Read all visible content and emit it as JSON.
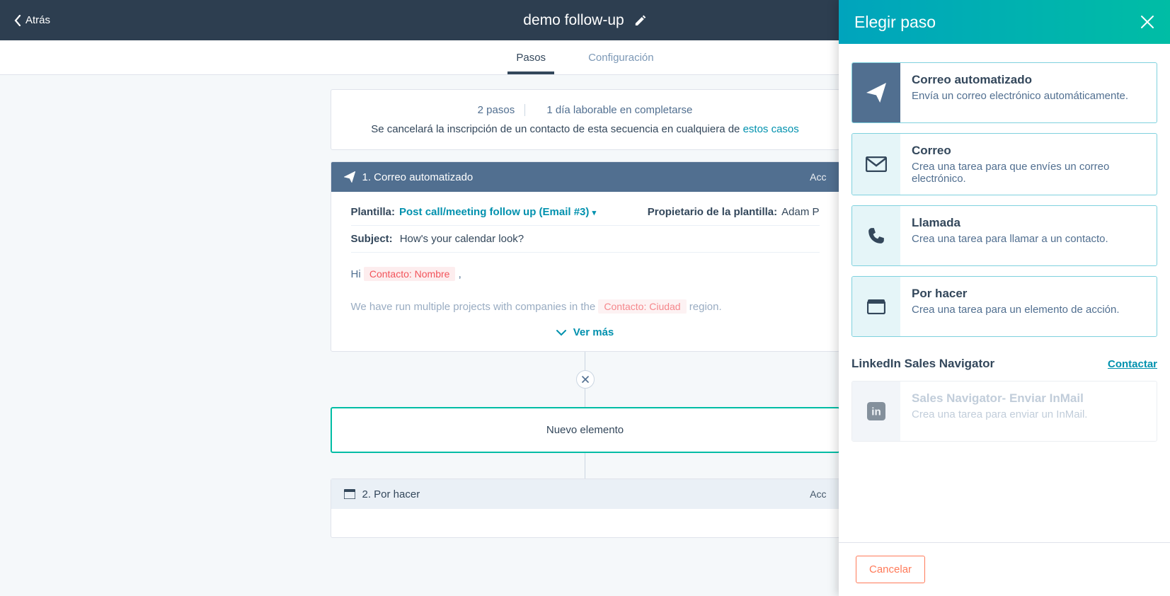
{
  "header": {
    "back": "Atrás",
    "title": "demo follow-up"
  },
  "tabs": {
    "steps": "Pasos",
    "config": "Configuración"
  },
  "summary": {
    "steps": "2 pasos",
    "duration": "1 día laborable en completarse",
    "cancel_text": "Se cancelará la inscripción de un contacto de esta secuencia en cualquiera de ",
    "cancel_link": "estos casos"
  },
  "step1": {
    "title": "1. Correo automatizado",
    "actions": "Acc",
    "template_label": "Plantilla:",
    "template_name": "Post call/meeting follow up (Email #3)",
    "owner_label": "Propietario de la plantilla:",
    "owner_name": "Adam P",
    "subject_label": "Subject:",
    "subject_value": "How's your calendar look?",
    "body_hi": "Hi ",
    "token_name": "Contacto: Nombre",
    "body_after_hi": " ,",
    "body_line2a": "We have run multiple projects with companies in the ",
    "token_city": "Contacto: Ciudad",
    "body_line2b": " region.",
    "ver_mas": "Ver más"
  },
  "new_element": "Nuevo elemento",
  "step2": {
    "title": "2. Por hacer",
    "actions": "Acc"
  },
  "panel": {
    "title": "Elegir paso",
    "options": [
      {
        "title": "Correo automatizado",
        "desc": "Envía un correo electrónico automáticamente."
      },
      {
        "title": "Correo",
        "desc": "Crea una tarea para que envíes un correo electrónico."
      },
      {
        "title": "Llamada",
        "desc": "Crea una tarea para llamar a un contacto."
      },
      {
        "title": "Por hacer",
        "desc": "Crea una tarea para un elemento de acción."
      }
    ],
    "linkedin_title": "LinkedIn Sales Navigator",
    "linkedin_contact": "Contactar",
    "linkedin_option": {
      "title": "Sales Navigator- Enviar InMail",
      "desc": "Crea una tarea para enviar un InMail."
    },
    "cancel": "Cancelar"
  }
}
